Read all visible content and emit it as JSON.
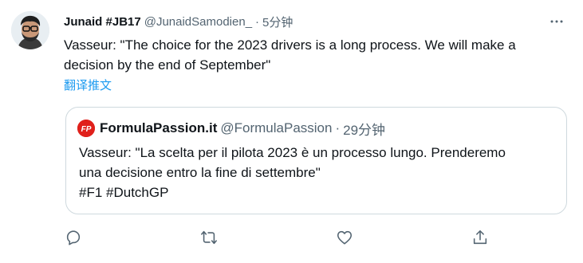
{
  "tweet": {
    "author_name": "Junaid #JB17",
    "author_handle": "@JunaidSamodien_",
    "separator": "·",
    "time": "5分钟",
    "text": "Vasseur: \"The choice for the 2023 drivers is a long process. We will make a decision by the end of September\"",
    "translate_label": "翻译推文"
  },
  "quoted_tweet": {
    "author_name": "FormulaPassion.it",
    "author_handle": "@FormulaPassion",
    "separator": "·",
    "time": "29分钟",
    "logo_text": "FP",
    "text_line1": "Vasseur: \"La scelta per il pilota 2023 è un processo lungo. Prenderemo",
    "text_line2": "una decisione entro la fine di settembre\"",
    "text_line3": "#F1 #DutchGP"
  },
  "actions": [
    "reply-icon",
    "retweet-icon",
    "like-icon",
    "share-icon"
  ],
  "colors": {
    "link": "#1d9bf0",
    "secondary_text": "#536471",
    "border": "#cfd9de",
    "logo_red": "#e0201b"
  }
}
